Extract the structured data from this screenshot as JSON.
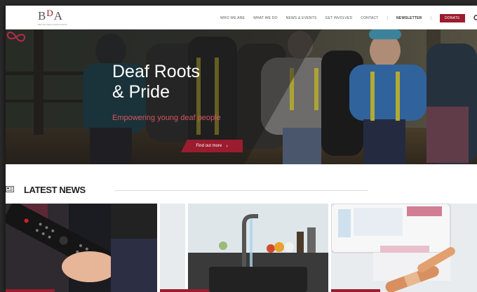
{
  "header": {
    "logo_text": "BDA",
    "logo_tagline": "BRITISH DEAF ASSOCIATION",
    "nav": [
      "WHO WE ARE",
      "WHAT WE DO",
      "NEWS & EVENTS",
      "GET INVOLVED",
      "CONTACT"
    ],
    "separator": "|",
    "newsletter": "NEWSLETTER",
    "donate": "DONATE",
    "icons": {
      "search": "search-icon"
    }
  },
  "hero": {
    "title": "Deaf Roots\n& Pride",
    "subtitle": "Empowering young deaf people",
    "button": "Find out more",
    "button_arrow": "›"
  },
  "news": {
    "heading": "LATEST NEWS",
    "icon": "newspaper-icon"
  },
  "colors": {
    "brand": "#9b1c2e",
    "accent_text": "#d45563"
  }
}
